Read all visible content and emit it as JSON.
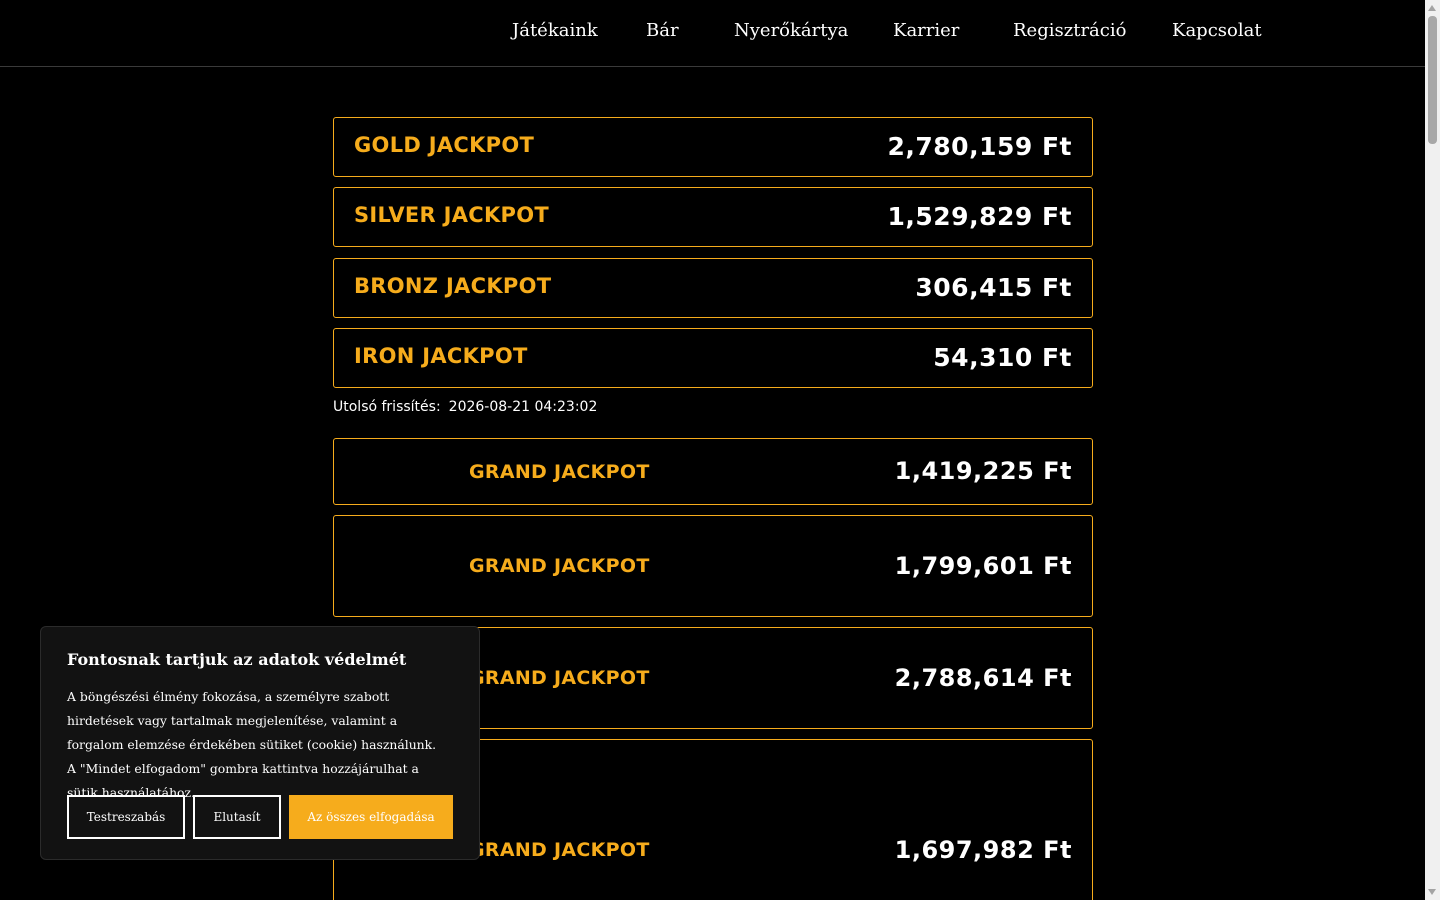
{
  "nav": {
    "items": [
      {
        "label": "Játékaink"
      },
      {
        "label": "Bár"
      },
      {
        "label": "Nyerőkártya"
      },
      {
        "label": "Karrier"
      },
      {
        "label": "Regisztráció"
      },
      {
        "label": "Kapcsolat"
      }
    ]
  },
  "jackpots": [
    {
      "name": "GOLD JACKPOT",
      "amount": "2,780,159 Ft"
    },
    {
      "name": "SILVER JACKPOT",
      "amount": "1,529,829 Ft"
    },
    {
      "name": "BRONZ JACKPOT",
      "amount": "306,415 Ft"
    },
    {
      "name": "IRON JACKPOT",
      "amount": "54,310 Ft"
    }
  ],
  "last_update": {
    "label": "Utolsó frissítés:",
    "value": "2026-08-21 04:23:02"
  },
  "grand_jackpots": [
    {
      "name": "GRAND JACKPOT",
      "amount": "1,419,225 Ft"
    },
    {
      "name": "GRAND JACKPOT",
      "amount": "1,799,601 Ft"
    },
    {
      "name": "GRAND JACKPOT",
      "amount": "2,788,614 Ft"
    },
    {
      "name": "GRAND JACKPOT",
      "amount": "1,697,982 Ft"
    }
  ],
  "cookie": {
    "title": "Fontosnak tartjuk az adatok védelmét",
    "text": "A böngészési élmény fokozása, a személyre szabott hirdetések vagy tartalmak megjelenítése, valamint a forgalom elemzése érdekében sütiket (cookie) használunk. A \"Mindet elfogadom\" gombra kattintva hozzájárulhat a sütik használatához.",
    "customize_label": "Testreszabás",
    "reject_label": "Elutasít",
    "accept_label": "Az összes elfogadása",
    "accent_color": "#f6ac1c"
  },
  "colors": {
    "background": "#000000",
    "accent": "#f6ac1c",
    "text": "#ffffff"
  }
}
